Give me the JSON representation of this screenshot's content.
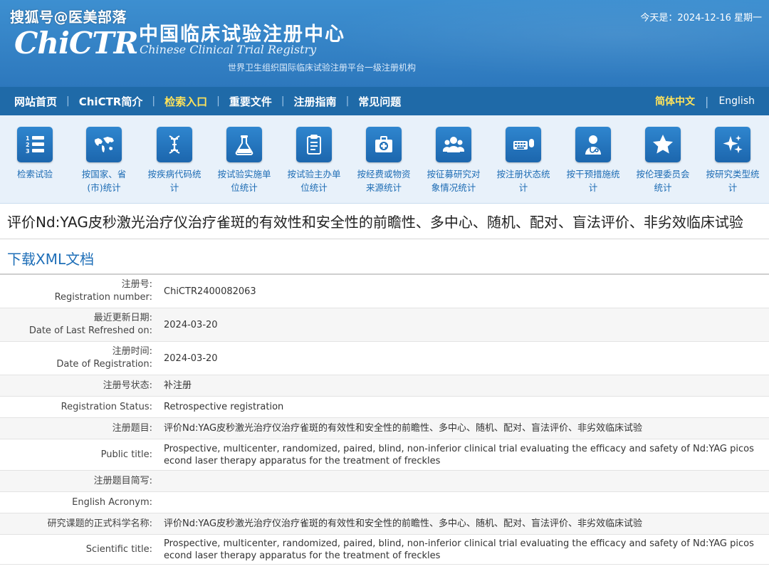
{
  "header": {
    "watermark": "搜狐号@医美部落",
    "logo_mark": "ChiCTR",
    "site_name_cn": "中国临床试验注册中心",
    "site_name_en": "Chinese Clinical Trial Registry",
    "subtitle": "世界卫生组织国际临床试验注册平台一级注册机构",
    "today": "今天是：2024-12-16 星期一"
  },
  "nav": {
    "items": [
      {
        "label": "网站首页",
        "active": false
      },
      {
        "label": "ChiCTR简介",
        "active": false
      },
      {
        "label": "检索入口",
        "active": true
      },
      {
        "label": "重要文件",
        "active": false
      },
      {
        "label": "注册指南",
        "active": false
      },
      {
        "label": "常见问题",
        "active": false
      }
    ],
    "lang_cn": "简体中文",
    "lang_en": "English"
  },
  "icons": [
    {
      "icon": "list-number-icon",
      "line1": "检索试验",
      "line2": ""
    },
    {
      "icon": "world-map-icon",
      "line1": "按国家、省",
      "line2": "(市)统计"
    },
    {
      "icon": "dna-icon",
      "line1": "按疾病代码统",
      "line2": "计"
    },
    {
      "icon": "flask-icon",
      "line1": "按试验实施单",
      "line2": "位统计"
    },
    {
      "icon": "clipboard-icon",
      "line1": "按试验主办单",
      "line2": "位统计"
    },
    {
      "icon": "medical-kit-icon",
      "line1": "按经费或物资",
      "line2": "来源统计"
    },
    {
      "icon": "people-group-icon",
      "line1": "按征募研究对",
      "line2": "象情况统计"
    },
    {
      "icon": "keyboard-mouse-icon",
      "line1": "按注册状态统",
      "line2": "计"
    },
    {
      "icon": "doctor-icon",
      "line1": "按干预措施统",
      "line2": "计"
    },
    {
      "icon": "star-icon",
      "line1": "按伦理委员会",
      "line2": "统计"
    },
    {
      "icon": "sparkle-icon",
      "line1": "按研究类型统",
      "line2": "计"
    }
  ],
  "page_title": "评价Nd:YAG皮秒激光治疗仪治疗雀斑的有效性和安全性的前瞻性、多中心、随机、配对、盲法评价、非劣效临床试验",
  "xml_link": "下载XML文档",
  "rows": [
    {
      "label_cn": "注册号:",
      "label_en": "Registration number:",
      "value": "ChiCTR2400082063",
      "value2": ""
    },
    {
      "label_cn": "最近更新日期:",
      "label_en": "Date of Last Refreshed on:",
      "value": "2024-03-20",
      "value2": ""
    },
    {
      "label_cn": "注册时间:",
      "label_en": "Date of Registration:",
      "value": "2024-03-20",
      "value2": ""
    },
    {
      "label_cn": "注册号状态:",
      "label_en": "",
      "value": "补注册",
      "value2": ""
    },
    {
      "label_cn": "",
      "label_en": "Registration Status:",
      "value": "Retrospective registration",
      "value2": ""
    },
    {
      "label_cn": "注册题目:",
      "label_en": "",
      "value": "评价Nd:YAG皮秒激光治疗仪治疗雀斑的有效性和安全性的前瞻性、多中心、随机、配对、盲法评价、非劣效临床试验",
      "value2": ""
    },
    {
      "label_cn": "",
      "label_en": "Public title:",
      "value": "Prospective, multicenter, randomized, paired, blind, non-inferior clinical trial evaluating the efficacy and safety of Nd:YAG picos",
      "value2": "econd laser therapy apparatus for the treatment of freckles"
    },
    {
      "label_cn": "注册题目简写:",
      "label_en": "",
      "value": "",
      "value2": ""
    },
    {
      "label_cn": "",
      "label_en": "English Acronym:",
      "value": "",
      "value2": ""
    },
    {
      "label_cn": "研究课题的正式科学名称:",
      "label_en": "",
      "value": "评价Nd:YAG皮秒激光治疗仪治疗雀斑的有效性和安全性的前瞻性、多中心、随机、配对、盲法评价、非劣效临床试验",
      "value2": ""
    },
    {
      "label_cn": "",
      "label_en": "Scientific title:",
      "value": "Prospective, multicenter, randomized, paired, blind, non-inferior clinical trial evaluating the efficacy and safety of Nd:YAG picos",
      "value2": "econd laser therapy apparatus for the treatment of freckles"
    }
  ]
}
